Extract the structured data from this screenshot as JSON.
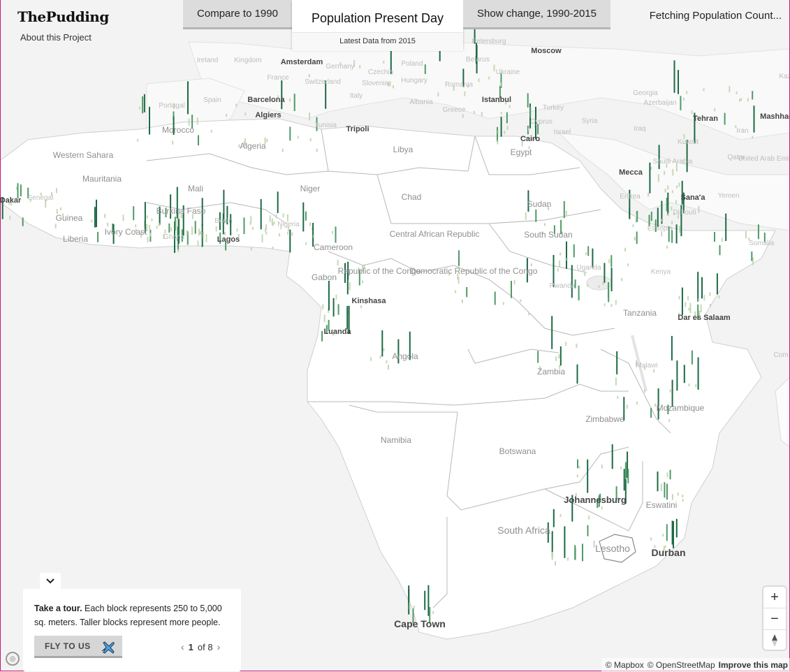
{
  "header": {
    "logo": "ThePudding",
    "about_link": "About this Project",
    "fetch_status": "Fetching Population Count..."
  },
  "tabs": {
    "left": "Compare to 1990",
    "active_title": "Population Present Day",
    "active_subtitle": "Latest Data from 2015",
    "right": "Show change, 1990-2015"
  },
  "tour": {
    "toggle_icon": "chevron-down-icon",
    "bold_text": "Take a tour.",
    "text": " Each block represents 250 to 5,000 sq. meters. Taller blocks represent more people.",
    "fly_button": "FLY TO US",
    "fly_icon": "airplane-icon",
    "page_current": "1",
    "page_of": "of 8"
  },
  "controls": {
    "zoom_in": "+",
    "zoom_out": "−",
    "compass": "▲"
  },
  "attribution": {
    "mapbox": "© Mapbox",
    "osm": "© OpenStreetMap",
    "improve": "Improve this map"
  },
  "map_labels": {
    "europe": [
      "Ireland",
      "Kingdom",
      "Amsterdam",
      "Germany",
      "Poland",
      "Belarus",
      "Moscow",
      "Petersburg",
      "Ukraine",
      "France",
      "Switzerland",
      "Czechia",
      "Hungary",
      "Romania",
      "Slovenia",
      "Italy",
      "Albania",
      "Greece",
      "Portugal",
      "Spain",
      "Barcelona",
      "Istanbul",
      "Turkey",
      "Cyprus",
      "Syria",
      "Israel",
      "Georgia",
      "Azerbaijan",
      "Iraq",
      "Iran",
      "Tehran",
      "Mashhad",
      "Kuwait",
      "Qatar",
      "United Arab Emirates",
      "Saudi Arabia",
      "Mecca",
      "Yemen",
      "Sana'a",
      "Kaz"
    ],
    "africa": [
      "Algiers",
      "Tunisia",
      "Tripoli",
      "Morocco",
      "Algeria",
      "Libya",
      "Egypt",
      "Cairo",
      "Western Sahara",
      "Mauritania",
      "Mali",
      "Niger",
      "Chad",
      "Sudan",
      "Eritrea",
      "Djibouti",
      "Ethiopia",
      "Somalia",
      "Dakar",
      "Senegal",
      "Guinea",
      "Burkina Faso",
      "Benin",
      "Nigeria",
      "Ivory Coast",
      "Ghana",
      "Liberia",
      "Lagos",
      "Cameroon",
      "Central African Republic",
      "South Sudan",
      "Uganda",
      "Kenya",
      "Gabon",
      "Republic of the Congo",
      "Democratic Republic of the Congo",
      "Rwanda",
      "Kinshasa",
      "Tanzania",
      "Dar es Salaam",
      "Luanda",
      "Angola",
      "Zambia",
      "Malawi",
      "Mozambique",
      "Zimbabwe",
      "Namibia",
      "Botswana",
      "Johannesburg",
      "Eswatini",
      "South Africa",
      "Lesotho",
      "Durban",
      "Cape Town",
      "Com"
    ]
  }
}
